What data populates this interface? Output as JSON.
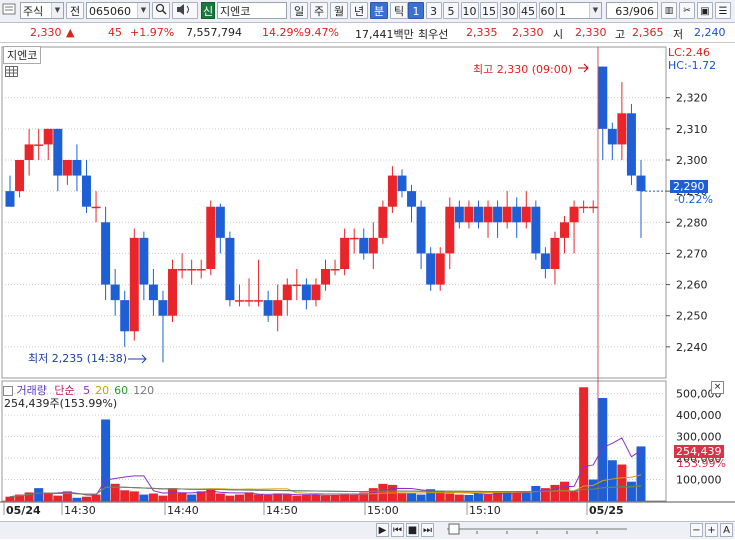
{
  "toolbar": {
    "category": "주식",
    "prefix": "전",
    "code": "065060",
    "badge": "신",
    "name": "지엔코",
    "periods": [
      "일",
      "주",
      "월",
      "년",
      "분",
      "틱"
    ],
    "active_period": "분",
    "intervals": [
      "1",
      "3",
      "5",
      "10",
      "15",
      "30",
      "45",
      "60"
    ],
    "active_interval": "1",
    "interval_input": "1",
    "page_counter": "63/906"
  },
  "quote": {
    "price": "2,330",
    "change_arrow": "▲",
    "change": "45",
    "change_pct": "+1.97%",
    "volume": "7,557,794",
    "rate1": "14.29%",
    "rate2": "9.47%",
    "amount": "17,441백만",
    "best_label": "최우선",
    "best_ask": "2,335",
    "best_bid": "2,330",
    "open_label": "시",
    "open": "2,330",
    "high_label": "고",
    "high": "2,365",
    "low_label": "저",
    "low": "2,240"
  },
  "price_panel": {
    "name_tag": "지엔코",
    "lc_label": "LC:2.46",
    "hc_label": "HC:-1.72",
    "max_label": "최고 2,330 (09:00)",
    "min_label": "최저 2,235 (14:38)",
    "current_price": "2,290",
    "current_pct": "-0.22%"
  },
  "volume_panel": {
    "title": "거래량",
    "ma_label": "단순",
    "ma_periods": [
      "5",
      "20",
      "60",
      "120"
    ],
    "ma_colors": [
      "#8b2fc9",
      "#d4a000",
      "#2a9d2a",
      "#7a7a7a"
    ],
    "current_text": "254,439주(153.99%)",
    "current_volume": "254,439",
    "current_pct": "153.99%"
  },
  "colors": {
    "up": "#e8252b",
    "down": "#1f5fd6",
    "axis": "#333333",
    "grid": "#c9c9c9"
  },
  "chart_data": [
    {
      "type": "candlestick",
      "x_labels": [
        "05/24",
        "14:30",
        "14:40",
        "14:50",
        "15:00",
        "15:10",
        "05/25"
      ],
      "y_ticks": [
        2240,
        2250,
        2260,
        2270,
        2280,
        2290,
        2300,
        2310,
        2320
      ],
      "ylim": [
        2230,
        2335
      ],
      "candles": [
        [
          2290,
          2285,
          2295,
          2285
        ],
        [
          2290,
          2300,
          2300,
          2288
        ],
        [
          2300,
          2305,
          2310,
          2295
        ],
        [
          2305,
          2305,
          2310,
          2300
        ],
        [
          2305,
          2310,
          2310,
          2300
        ],
        [
          2310,
          2295,
          2310,
          2290
        ],
        [
          2295,
          2300,
          2300,
          2292
        ],
        [
          2300,
          2295,
          2305,
          2290
        ],
        [
          2295,
          2285,
          2300,
          2283
        ],
        [
          2285,
          2285,
          2290,
          2280
        ],
        [
          2280,
          2260,
          2285,
          2255
        ],
        [
          2260,
          2255,
          2265,
          2250
        ],
        [
          2255,
          2245,
          2258,
          2240
        ],
        [
          2245,
          2275,
          2278,
          2242
        ],
        [
          2275,
          2260,
          2277,
          2255
        ],
        [
          2260,
          2255,
          2265,
          2250
        ],
        [
          2255,
          2250,
          2258,
          2235
        ],
        [
          2250,
          2265,
          2268,
          2248
        ],
        [
          2265,
          2265,
          2270,
          2262
        ],
        [
          2265,
          2265,
          2268,
          2260
        ],
        [
          2265,
          2265,
          2268,
          2262
        ],
        [
          2265,
          2285,
          2287,
          2263
        ],
        [
          2285,
          2275,
          2286,
          2270
        ],
        [
          2275,
          2255,
          2277,
          2253
        ],
        [
          2255,
          2255,
          2260,
          2253
        ],
        [
          2255,
          2255,
          2262,
          2253
        ],
        [
          2255,
          2255,
          2268,
          2253
        ],
        [
          2255,
          2250,
          2258,
          2248
        ],
        [
          2250,
          2255,
          2260,
          2245
        ],
        [
          2255,
          2260,
          2262,
          2250
        ],
        [
          2260,
          2260,
          2265,
          2255
        ],
        [
          2260,
          2255,
          2262,
          2252
        ],
        [
          2255,
          2260,
          2262,
          2253
        ],
        [
          2260,
          2265,
          2268,
          2258
        ],
        [
          2265,
          2265,
          2268,
          2263
        ],
        [
          2265,
          2275,
          2278,
          2263
        ],
        [
          2275,
          2275,
          2278,
          2270
        ],
        [
          2275,
          2270,
          2278,
          2268
        ],
        [
          2270,
          2275,
          2280,
          2265
        ],
        [
          2275,
          2285,
          2287,
          2273
        ],
        [
          2285,
          2295,
          2298,
          2283
        ],
        [
          2295,
          2290,
          2297,
          2288
        ],
        [
          2290,
          2285,
          2292,
          2280
        ],
        [
          2285,
          2270,
          2287,
          2265
        ],
        [
          2270,
          2260,
          2272,
          2258
        ],
        [
          2260,
          2270,
          2272,
          2258
        ],
        [
          2270,
          2285,
          2288,
          2265
        ],
        [
          2285,
          2280,
          2287,
          2278
        ],
        [
          2280,
          2285,
          2287,
          2278
        ],
        [
          2285,
          2280,
          2287,
          2278
        ],
        [
          2280,
          2285,
          2287,
          2275
        ],
        [
          2285,
          2280,
          2287,
          2275
        ],
        [
          2280,
          2285,
          2290,
          2278
        ],
        [
          2285,
          2280,
          2288,
          2275
        ],
        [
          2280,
          2285,
          2290,
          2278
        ],
        [
          2285,
          2270,
          2287,
          2268
        ],
        [
          2270,
          2265,
          2272,
          2262
        ],
        [
          2265,
          2275,
          2277,
          2260
        ],
        [
          2275,
          2280,
          2282,
          2270
        ],
        [
          2280,
          2285,
          2287,
          2270
        ],
        [
          2285,
          2285,
          2287,
          2283
        ],
        [
          2285,
          2285,
          2287,
          2283
        ],
        [
          2330,
          2310,
          2330,
          2300
        ],
        [
          2310,
          2305,
          2312,
          2300
        ],
        [
          2305,
          2315,
          2325,
          2300
        ],
        [
          2315,
          2295,
          2318,
          2292
        ],
        [
          2295,
          2290,
          2300,
          2275
        ]
      ],
      "max_marker": {
        "value": 2330,
        "time": "09:00"
      },
      "min_marker": {
        "value": 2235,
        "time": "14:38"
      }
    },
    {
      "type": "bar",
      "y_ticks": [
        100000,
        200000,
        300000,
        400000,
        500000
      ],
      "ylim": [
        0,
        550000
      ],
      "values": [
        20000,
        30000,
        40000,
        60000,
        35000,
        25000,
        45000,
        15000,
        20000,
        30000,
        380000,
        80000,
        50000,
        45000,
        30000,
        35000,
        25000,
        60000,
        40000,
        30000,
        45000,
        55000,
        35000,
        25000,
        30000,
        40000,
        30000,
        28000,
        35000,
        30000,
        25000,
        28000,
        30000,
        25000,
        28000,
        32000,
        30000,
        40000,
        60000,
        80000,
        75000,
        40000,
        35000,
        30000,
        55000,
        45000,
        35000,
        30000,
        28000,
        35000,
        30000,
        40000,
        45000,
        35000,
        38000,
        70000,
        60000,
        75000,
        90000,
        45000,
        530000,
        100000,
        480000,
        190000,
        170000,
        90000,
        254439
      ],
      "colors": [
        "up",
        "up",
        "up",
        "down",
        "up",
        "up",
        "up",
        "down",
        "up",
        "up",
        "down",
        "up",
        "up",
        "up",
        "down",
        "up",
        "up",
        "up",
        "up",
        "down",
        "up",
        "up",
        "up",
        "up",
        "up",
        "up",
        "up",
        "up",
        "up",
        "up",
        "up",
        "up",
        "up",
        "up",
        "up",
        "up",
        "up",
        "up",
        "up",
        "up",
        "up",
        "up",
        "down",
        "down",
        "down",
        "up",
        "up",
        "up",
        "down",
        "down",
        "up",
        "up",
        "down",
        "up",
        "down",
        "down",
        "up",
        "up",
        "up",
        "up",
        "up",
        "down",
        "down",
        "down",
        "up",
        "down",
        "down"
      ]
    }
  ]
}
